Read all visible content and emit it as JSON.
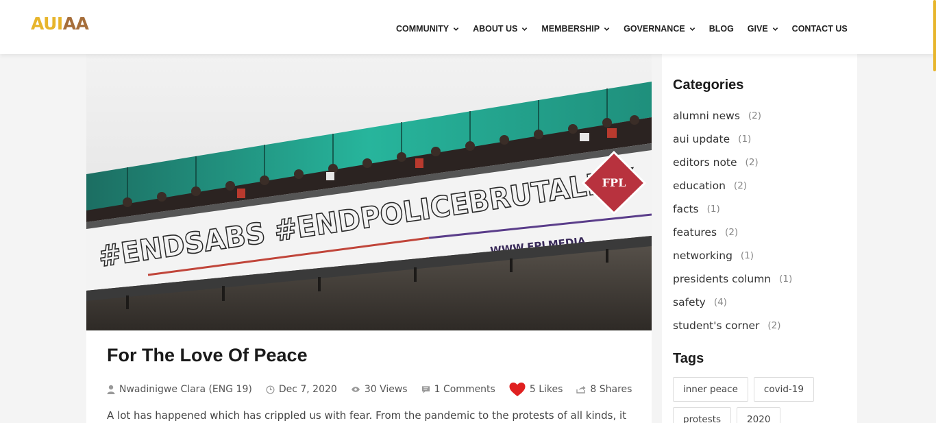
{
  "logo": {
    "part1": "AUI",
    "part2": "AA"
  },
  "nav": [
    {
      "label": "COMMUNITY",
      "dropdown": true
    },
    {
      "label": "ABOUT US",
      "dropdown": true
    },
    {
      "label": "MEMBERSHIP",
      "dropdown": true
    },
    {
      "label": "GOVERNANCE",
      "dropdown": true
    },
    {
      "label": "BLOG",
      "dropdown": false
    },
    {
      "label": "GIVE",
      "dropdown": true
    },
    {
      "label": "CONTACT US",
      "dropdown": false
    }
  ],
  "hero": {
    "banner_text": "#ENDSABS #ENDPOLICEBRUTALITY",
    "brand_badge": "FPL",
    "banner_url_text": "WWW.FPLMEDIA"
  },
  "article": {
    "title": "For The Love Of Peace",
    "author": "Nwadinigwe Clara (ENG 19)",
    "date": "Dec 7, 2020",
    "views": "30 Views",
    "comments": "1 Comments",
    "likes": "5 Likes",
    "shares": "8 Shares",
    "excerpt": "A lot has happened which has crippled us with fear. From the pandemic to the protests of all kinds, it"
  },
  "sidebar": {
    "categories_heading": "Categories",
    "categories": [
      {
        "name": "alumni news",
        "count": "(2)"
      },
      {
        "name": "aui update",
        "count": "(1)"
      },
      {
        "name": "editors note",
        "count": "(2)"
      },
      {
        "name": "education",
        "count": "(2)"
      },
      {
        "name": "facts",
        "count": "(1)"
      },
      {
        "name": "features",
        "count": "(2)"
      },
      {
        "name": "networking",
        "count": "(1)"
      },
      {
        "name": "presidents column",
        "count": "(1)"
      },
      {
        "name": "safety",
        "count": "(4)"
      },
      {
        "name": "student's corner",
        "count": "(2)"
      }
    ],
    "tags_heading": "Tags",
    "tags": [
      "inner peace",
      "covid-19",
      "protests",
      "2020"
    ]
  },
  "colors": {
    "accent": "#e7b52c",
    "brand_secondary": "#a66e3a",
    "like_heart": "#e02020"
  }
}
